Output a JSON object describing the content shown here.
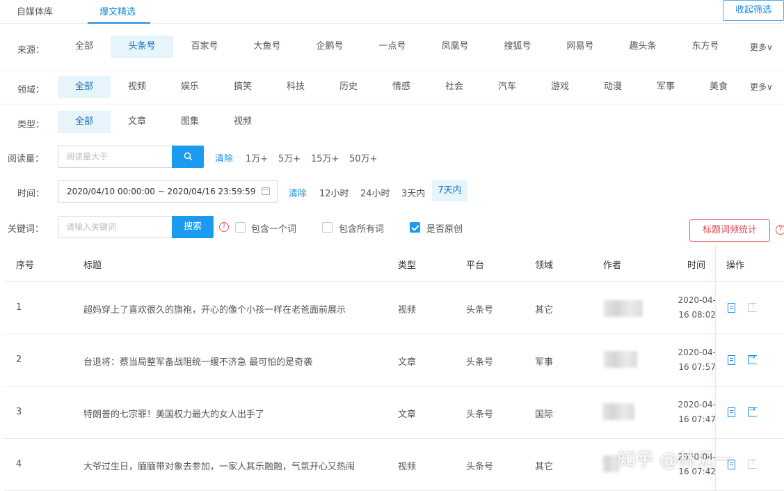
{
  "tabs": [
    {
      "label": "自媒体库",
      "active": false
    },
    {
      "label": "爆文精选",
      "active": true
    }
  ],
  "collapse_label": "收起筛选",
  "source": {
    "label": "来源：",
    "options": [
      "全部",
      "头条号",
      "百家号",
      "大鱼号",
      "企鹅号",
      "一点号",
      "凤凰号",
      "搜狐号",
      "网易号",
      "趣头条",
      "东方号"
    ],
    "active": "头条号",
    "more": "更多∨"
  },
  "domain": {
    "label": "领域：",
    "options": [
      "全部",
      "视频",
      "娱乐",
      "搞笑",
      "科技",
      "历史",
      "情感",
      "社会",
      "汽车",
      "游戏",
      "动漫",
      "军事",
      "美食"
    ],
    "active": "全部",
    "more": "更多∨"
  },
  "type": {
    "label": "类型：",
    "options": [
      "全部",
      "文章",
      "图集",
      "视频"
    ],
    "active": "全部"
  },
  "reads": {
    "label": "阅读量：",
    "placeholder": "阅读量大于",
    "clear": "清除",
    "presets": [
      "1万+",
      "5万+",
      "15万+",
      "50万+"
    ]
  },
  "time": {
    "label": "时间：",
    "range": "2020/04/10 00:00:00 ~ 2020/04/16 23:59:59",
    "clear": "清除",
    "presets": [
      "12小时",
      "24小时",
      "3天内",
      "7天内"
    ],
    "active": "7天内"
  },
  "keyword": {
    "label": "关键词：",
    "placeholder": "请输入关键词",
    "search": "搜索",
    "help": "?",
    "checks": [
      {
        "label": "包含一个词",
        "checked": false
      },
      {
        "label": "包含所有词",
        "checked": false
      },
      {
        "label": "是否原创",
        "checked": true
      }
    ],
    "stats_button": "标题词频统计"
  },
  "table": {
    "headers": [
      "序号",
      "标题",
      "类型",
      "平台",
      "领域",
      "作者",
      "时间",
      "操作"
    ],
    "rows": [
      {
        "idx": "1",
        "title": "超妈穿上了喜欢很久的旗袍，开心的像个小孩一样在老爸面前展示",
        "type": "视频",
        "platform": "头条号",
        "domain": "其它",
        "date": "2020-04-",
        "time": "16 08:02"
      },
      {
        "idx": "2",
        "title": "台退将：蔡当局整军备战阻统一缓不济急 最可怕的是奇袭",
        "type": "文章",
        "platform": "头条号",
        "domain": "军事",
        "date": "2020-04-",
        "time": "16 07:57"
      },
      {
        "idx": "3",
        "title": "特朗普的七宗罪！美国权力最大的女人出手了",
        "type": "文章",
        "platform": "头条号",
        "domain": "国际",
        "date": "2020-04-",
        "time": "16 07:47"
      },
      {
        "idx": "4",
        "title": "大爷过生日，腼腼带对象去参加，一家人其乐融融，气氛开心又热闹",
        "type": "视频",
        "platform": "头条号",
        "domain": "其它",
        "date": "2020-04-",
        "time": "16 07:42"
      }
    ]
  },
  "watermark": "知乎 @林见一",
  "colors": {
    "accent": "#1a9bf0",
    "active_bg": "#e6f4fc",
    "danger": "#e0454f"
  }
}
